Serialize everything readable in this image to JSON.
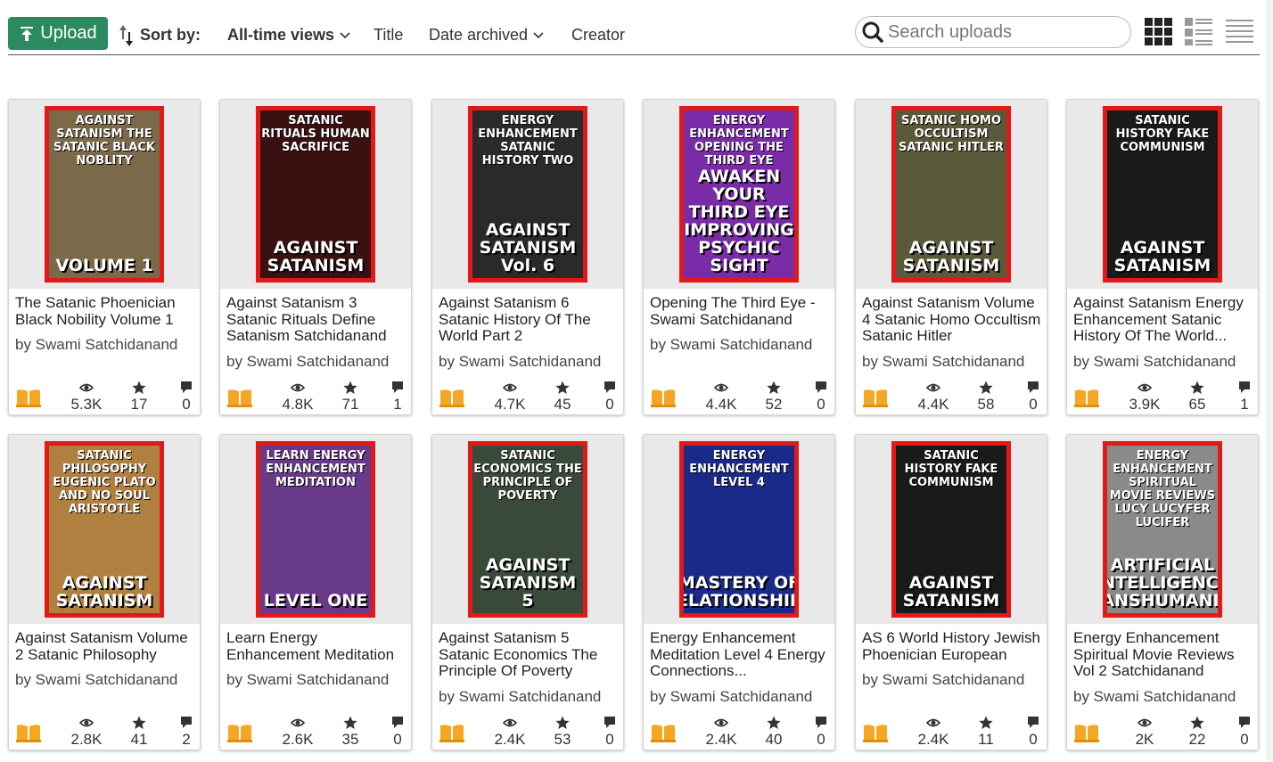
{
  "toolbar": {
    "upload_label": "Upload",
    "sort_by_label": "Sort by:",
    "sort_options": [
      "All-time views",
      "Title",
      "Date archived",
      "Creator"
    ],
    "active_sort": "All-time views",
    "search_placeholder": "Search uploads"
  },
  "colors": {
    "upload_green": "#2b8a5f",
    "reader_orange": "#f5a623",
    "cover_red": "#e11919"
  },
  "items": [
    {
      "title": "The Satanic Phoenician Black Nobility Volume 1",
      "creator": "by Swami Satchidanand",
      "views": "5.3K",
      "favorites": "17",
      "comments": "0",
      "cover_top": "AGAINST SATANISM THE SATANIC BLACK NOBLITY",
      "cover_bottom": "VOLUME 1",
      "cover_bg": "#7a6a4a"
    },
    {
      "title": "Against Satanism 3 Satanic Rituals Define Satanism Satchidanand",
      "creator": "by Swami Satchidanand",
      "views": "4.8K",
      "favorites": "71",
      "comments": "1",
      "cover_top": "SATANIC RITUALS HUMAN SACRIFICE",
      "cover_bottom": "AGAINST SATANISM",
      "cover_bg": "#3a1010"
    },
    {
      "title": "Against Satanism 6 Satanic History Of The World Part 2",
      "creator": "by Swami Satchidanand",
      "views": "4.7K",
      "favorites": "45",
      "comments": "0",
      "cover_top": "ENERGY ENHANCEMENT SATANIC HISTORY TWO",
      "cover_bottom": "AGAINST SATANISM Vol. 6",
      "cover_bg": "#2a2a2a"
    },
    {
      "title": "Opening The Third Eye - Swami Satchidanand",
      "creator": "by Swami Satchidanand",
      "views": "4.4K",
      "favorites": "52",
      "comments": "0",
      "cover_top": "ENERGY ENHANCEMENT OPENING THE THIRD EYE",
      "cover_bottom": "AWAKEN YOUR THIRD EYE IMPROVING PSYCHIC SIGHT",
      "cover_bg": "#7a2ba8"
    },
    {
      "title": "Against Satanism Volume 4 Satanic Homo Occultism Satanic Hitler",
      "creator": "by Swami Satchidanand",
      "views": "4.4K",
      "favorites": "58",
      "comments": "0",
      "cover_top": "SATANIC HOMO OCCULTISM SATANIC HITLER",
      "cover_bottom": "AGAINST SATANISM",
      "cover_bg": "#5a5a3a"
    },
    {
      "title": "Against Satanism Energy Enhancement Satanic History Of The World...",
      "creator": "by Swami Satchidanand",
      "views": "3.9K",
      "favorites": "65",
      "comments": "1",
      "cover_top": "SATANIC HISTORY FAKE COMMUNISM",
      "cover_bottom": "AGAINST SATANISM",
      "cover_bg": "#1a1a1a"
    },
    {
      "title": "Against Satanism Volume 2 Satanic Philosophy",
      "creator": "by Swami Satchidanand",
      "views": "2.8K",
      "favorites": "41",
      "comments": "2",
      "cover_top": "SATANIC PHILOSOPHY EUGENIC PLATO AND NO SOUL ARISTOTLE",
      "cover_bottom": "AGAINST SATANISM",
      "cover_bg": "#b08040"
    },
    {
      "title": "Learn Energy Enhancement Meditation",
      "creator": "by Swami Satchidanand",
      "views": "2.6K",
      "favorites": "35",
      "comments": "0",
      "cover_top": "LEARN ENERGY ENHANCEMENT MEDITATION",
      "cover_bottom": "LEVEL ONE",
      "cover_bg": "#6a3a8a"
    },
    {
      "title": "Against Satanism 5 Satanic Economics The Principle Of Poverty",
      "creator": "by Swami Satchidanand",
      "views": "2.4K",
      "favorites": "53",
      "comments": "0",
      "cover_top": "SATANIC ECONOMICS THE PRINCIPLE OF POVERTY",
      "cover_bottom": "AGAINST SATANISM 5",
      "cover_bg": "#3a4a3a"
    },
    {
      "title": "Energy Enhancement Meditation Level 4 Energy Connections...",
      "creator": "by Swami Satchidanand",
      "views": "2.4K",
      "favorites": "40",
      "comments": "0",
      "cover_top": "ENERGY ENHANCEMENT LEVEL 4",
      "cover_bottom": "MASTERY OF RELATIONSHIPS",
      "cover_bg": "#1a2a8a"
    },
    {
      "title": "AS 6 World History Jewish Phoenician European",
      "creator": "by Swami Satchidanand",
      "views": "2.4K",
      "favorites": "11",
      "comments": "0",
      "cover_top": "SATANIC HISTORY FAKE COMMUNISM",
      "cover_bottom": "AGAINST SATANISM",
      "cover_bg": "#1a1a1a"
    },
    {
      "title": "Energy Enhancement Spiritual Movie Reviews Vol 2 Satchidanand",
      "creator": "by Swami Satchidanand",
      "views": "2K",
      "favorites": "22",
      "comments": "0",
      "cover_top": "ENERGY ENHANCEMENT SPIRITUAL MOVIE REVIEWS LUCY LUCYFER LUCIFER",
      "cover_bottom": "ARTIFICIAL INTELLIGENCE TRANSHUMANISM",
      "cover_bg": "#8a8a8a"
    }
  ]
}
